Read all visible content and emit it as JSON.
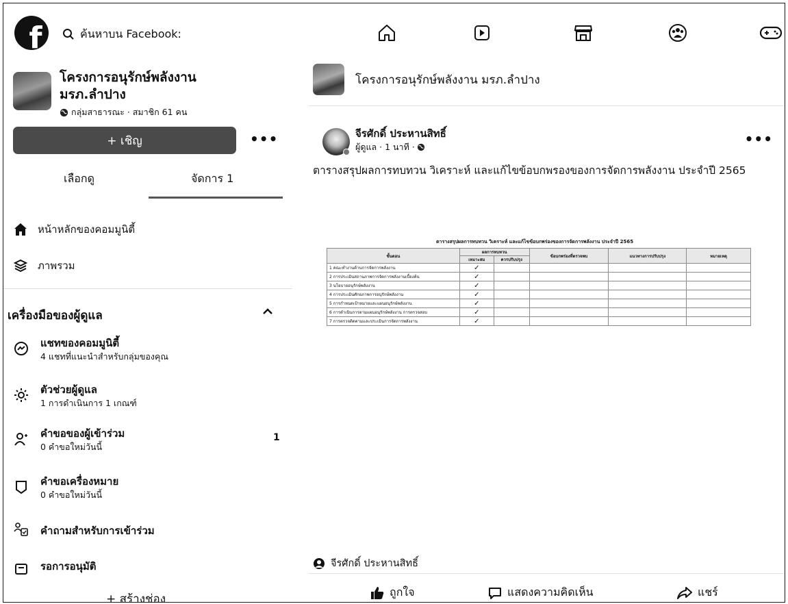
{
  "topbar": {
    "logo_letter": "f",
    "search_placeholder": "ค้นหาบน Facebook:",
    "nav_icons": [
      "home-icon",
      "video-icon",
      "marketplace-icon",
      "groups-icon",
      "gaming-icon"
    ]
  },
  "group": {
    "name": "โครงการอนุรักษ์พลังงาน มรภ.ลำปาง",
    "meta": "กลุ่มสาธารณะ · สมาชิก 61 คน",
    "invite_label": "+ เชิญ",
    "more": "•••"
  },
  "tabs": {
    "browse": "เลือกดู",
    "manage": "จัดการ 1"
  },
  "community_menu": [
    {
      "label": "หน้าหลักของคอมมูนิตี้",
      "icon": "home-filled-icon"
    },
    {
      "label": "ภาพรวม",
      "icon": "overview-icon"
    }
  ],
  "admin_tools": {
    "title": "เครื่องมือของผู้ดูแล",
    "collapse_icon": "chevron-up-icon",
    "items": [
      {
        "title": "แชทของคอมมูนิตี้",
        "subtitle": "4 แชทที่แนะนำสำหรับกลุ่มของคุณ",
        "icon": "messenger-icon",
        "badge": ""
      },
      {
        "title": "ตัวช่วยผู้ดูแล",
        "subtitle": "1 การดำเนินการ 1 เกณฑ์",
        "icon": "admin-assist-icon",
        "badge": ""
      },
      {
        "title": "คำขอของผู้เข้าร่วม",
        "subtitle": "0 คำขอใหม่วันนี้",
        "icon": "member-request-icon",
        "badge": "1"
      },
      {
        "title": "คำขอเครื่องหมาย",
        "subtitle": "0 คำขอใหม่วันนี้",
        "icon": "badge-request-icon",
        "badge": ""
      },
      {
        "title": "คำถามสำหรับการเข้าร่วม",
        "subtitle": "",
        "icon": "membership-questions-icon",
        "badge": ""
      },
      {
        "title": "รอการอนุมัติ",
        "subtitle": "",
        "icon": "pending-icon",
        "badge": ""
      }
    ],
    "create_chat": "+ สร้างช่อง"
  },
  "main": {
    "group_title": "โครงการอนุรักษ์พลังงาน มรภ.ลำปาง",
    "post": {
      "author": "จีรศักดิ์ ประหานสิทธิ์",
      "meta": "ผู้ดูแล · 1 นาที ·",
      "more": "•••",
      "text": "ตารางสรุปผลการทบทวน วิเคราะห์ และแก้ไขข้อบกพรองของการจัดการพลังงาน ประจำปี 2565",
      "document": {
        "title": "ตารางสรุปผลการทบทวน วิเคราะห์ และแก้ไขข้อบกพร่องของการจัดการพลังงาน ประจำปี 2565",
        "headers": [
          "ขั้นตอน",
          "ผลการทบทวน",
          "",
          "ข้อบกพร่องที่ตรวจพบ",
          "แนวทางการปรับปรุง",
          "หมายเหตุ"
        ],
        "subheaders": [
          "เหมาะสม",
          "ควรปรับปรุง"
        ],
        "rows": [
          {
            "topic": "1 คณะทำงานด้านการจัดการพลังงาน",
            "check": "✓"
          },
          {
            "topic": "2 การประเมินสถานภาพการจัดการพลังงานเบื้องต้น",
            "check": "✓"
          },
          {
            "topic": "3 นโยบายอนุรักษ์พลังงาน",
            "check": "✓"
          },
          {
            "topic": "4 การประเมินศักยภาพการอนุรักษ์พลังงาน",
            "check": "✓"
          },
          {
            "topic": "5 การกำหนดเป้าหมายและแผนอนุรักษ์พลังงาน",
            "check": "✓"
          },
          {
            "topic": "6 การดำเนินการตามแผนอนุรักษ์พลังงาน การตรวจสอบ",
            "check": "✓"
          },
          {
            "topic": "7 การตรวจติดตามและประเมินการจัดการพลังงาน",
            "check": "✓"
          }
        ]
      },
      "shared_by": "จีรศักดิ์ ประหานสิทธิ์",
      "actions": {
        "like": "ถูกใจ",
        "comment": "แสดงความคิดเห็น",
        "share": "แชร์"
      }
    }
  }
}
